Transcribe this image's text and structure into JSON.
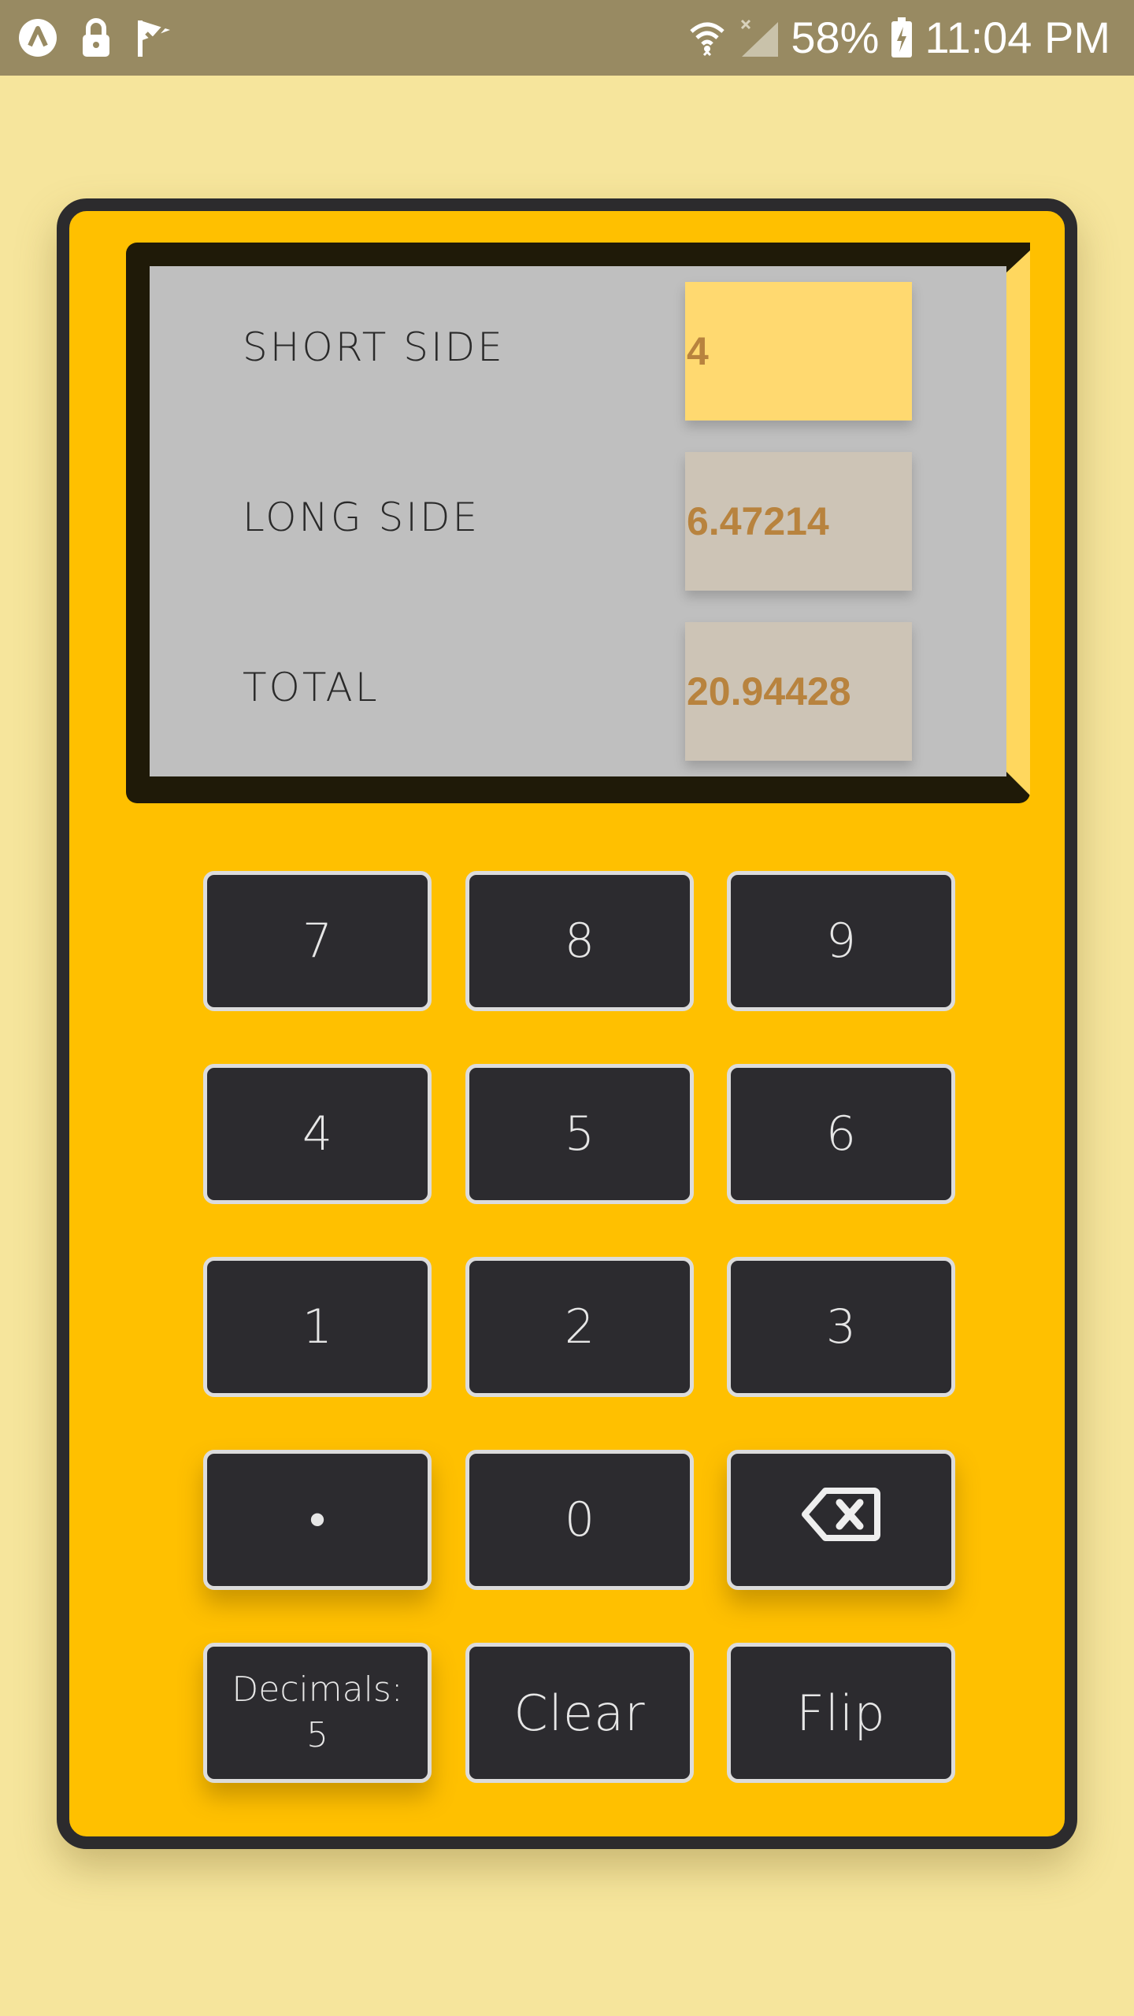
{
  "status_bar": {
    "battery": "58%",
    "time": "11:04 PM",
    "left_icons": [
      "app-logo-icon",
      "lock-icon",
      "checkmark-flag-icon"
    ],
    "right_icons": [
      "wifi-icon",
      "no-signal-icon",
      "battery-charging-icon"
    ]
  },
  "display": {
    "rows": [
      {
        "label": "SHORT SIDE",
        "value": "4",
        "active": true
      },
      {
        "label": "LONG SIDE",
        "value": "6.47214",
        "active": false
      },
      {
        "label": "TOTAL",
        "value": "20.94428",
        "active": false
      }
    ]
  },
  "keypad": {
    "k7": "7",
    "k8": "8",
    "k9": "9",
    "k4": "4",
    "k5": "5",
    "k6": "6",
    "k1": "1",
    "k2": "2",
    "k3": "3",
    "dot": "•",
    "k0": "0",
    "backspace_icon": "backspace-icon",
    "decimals_label": "Decimals:",
    "decimals_value": "5",
    "clear": "Clear",
    "flip": "Flip"
  },
  "colors": {
    "background": "#f6e59c",
    "status_bar": "#988a62",
    "calculator_body": "#ffc000",
    "frame": "#2c2b2d",
    "screen": "#bfbfbf",
    "active_field": "#ffd970",
    "value_text": "#b8833e",
    "key": "#2c2b2f"
  }
}
